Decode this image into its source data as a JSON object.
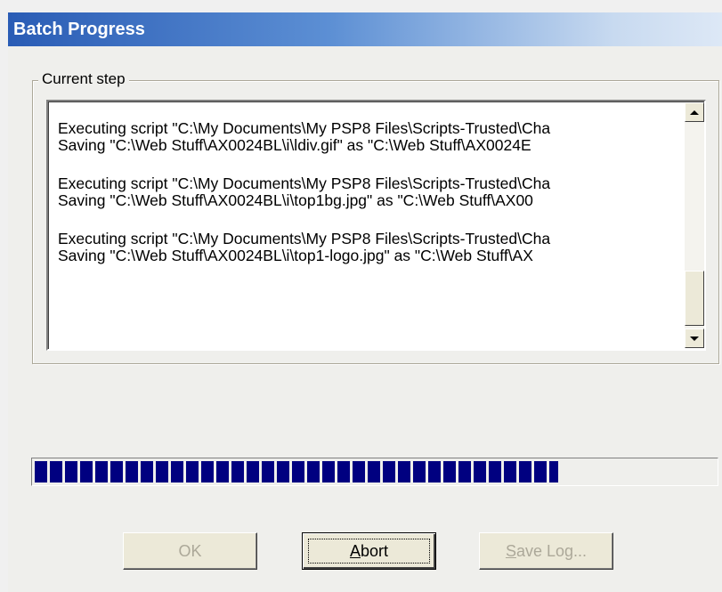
{
  "window": {
    "title": "Batch Progress"
  },
  "current_step": {
    "label": "Current step",
    "log": [
      {
        "exec": "Executing script \"C:\\My Documents\\My PSP8 Files\\Scripts-Trusted\\Cha",
        "save": "Saving \"C:\\Web Stuff\\AX0024BL\\i\\ldiv.gif\" as \"C:\\Web Stuff\\AX0024E"
      },
      {
        "exec": "Executing script \"C:\\My Documents\\My PSP8 Files\\Scripts-Trusted\\Cha",
        "save": "Saving \"C:\\Web Stuff\\AX0024BL\\i\\top1bg.jpg\" as \"C:\\Web Stuff\\AX00"
      },
      {
        "exec": "Executing script \"C:\\My Documents\\My PSP8 Files\\Scripts-Trusted\\Cha",
        "save": "Saving \"C:\\Web Stuff\\AX0024BL\\i\\top1-logo.jpg\" as \"C:\\Web Stuff\\AX"
      }
    ]
  },
  "progress": {
    "fraction": 0.77
  },
  "buttons": {
    "ok": {
      "label": "OK",
      "enabled": false
    },
    "abort": {
      "accel": "A",
      "rest": "bort",
      "enabled": true
    },
    "save_log": {
      "accel": "S",
      "rest": "ave Log...",
      "enabled": false
    }
  },
  "colors": {
    "progress_fill": "#000080",
    "title_gradient_start": "#2a5cb5",
    "title_gradient_end": "#dde8f6",
    "dialog_bg": "#efefec"
  }
}
